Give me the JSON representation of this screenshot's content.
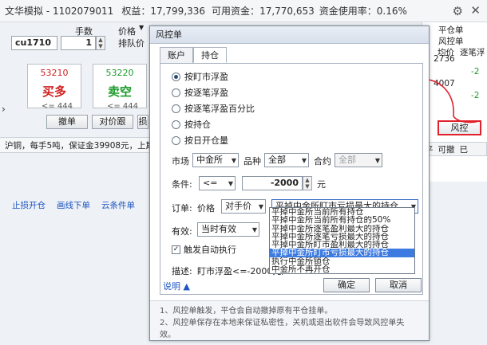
{
  "window": {
    "title": "文华模拟 - 1102079011",
    "equity_label": "权益：",
    "equity_value": "17,799,336",
    "available_label": "可用资金：",
    "available_value": "17,770,653",
    "usage_label": "资金使用率：",
    "usage_value": "0.16%"
  },
  "order_panel": {
    "qty_label": "手数",
    "qty_value": "1",
    "price_label": "价格",
    "queue_label": "排队价",
    "contract_value": "cu1710",
    "buy_price": "53210",
    "buy_label": "买多",
    "sell_price": "53220",
    "sell_label": "卖空",
    "buy_limit": "<= 444",
    "sell_limit": "<= 444",
    "btn_cancel": "撤单",
    "btn_counter": "对价跟",
    "btn_more": "损"
  },
  "infobar": {
    "text": "沪铜，每手5吨，保证金39908元，上期"
  },
  "bottom_links": [
    "止损开仓",
    "画线下单",
    "云条件单"
  ],
  "right_panel": {
    "col1": "平仓单",
    "col2": "风控单",
    "col3": "均价",
    "col4": "逐笔浮",
    "rows": [
      {
        "v": "2736",
        "d": ""
      },
      {
        "v": "",
        "d": "-2"
      },
      {
        "v": "4007",
        "d": ""
      },
      {
        "v": "",
        "d": "-2"
      }
    ],
    "risk_button": "风控",
    "hdr1": "平",
    "hdr2": "可撤",
    "hdr3": "已"
  },
  "dialog": {
    "title": "风控单",
    "tabs": [
      "账户",
      "持仓"
    ],
    "radios": [
      "按盯市浮盈",
      "按逐笔浮盈",
      "按逐笔浮盈百分比",
      "按持仓",
      "按日开仓量"
    ],
    "market_label": "市场",
    "market_value": "中金所",
    "variety_label": "品种",
    "variety_value": "全部",
    "contract_label": "合约",
    "contract_value": "全部",
    "cond_label": "条件:",
    "cond_value": "<=",
    "amount_value": "-2000",
    "amount_unit": "元",
    "order_label": "订单:",
    "price_label": "价格",
    "price_value": "对手价",
    "action_value": "平掉中金所盯市亏损最大的持仓",
    "valid_label": "有效:",
    "valid_value": "当时有效",
    "auto_label": "触发自动执行",
    "desc_label": "描述:",
    "desc_value": "盯市浮盈<=-2000元,",
    "help_label": "说明",
    "ok": "确定",
    "cancel": "取消",
    "options": [
      "平掉中金所当前所有持仓",
      "平掉中金所当前所有持仓的50%",
      "平掉中金所逐笔盈利最大的持仓",
      "平掉中金所逐笔亏损最大的持仓",
      "平掉中金所盯市盈利最大的持仓",
      "平掉中金所盯市亏损最大的持仓",
      "执行中金所锁仓",
      "中金所不再开仓"
    ],
    "highlighted_index": 5,
    "footer_lines": [
      "1、风控单触发，平仓会自动撤掉原有平仓挂单。",
      "2、风控单保存在本地来保证私密性，关机或退出软件会导致风控单失效。"
    ]
  },
  "colors": {
    "buy": "#d02020",
    "sell": "#1a9a2a",
    "accent": "#3d7be0",
    "annotation": "#e0202a"
  }
}
